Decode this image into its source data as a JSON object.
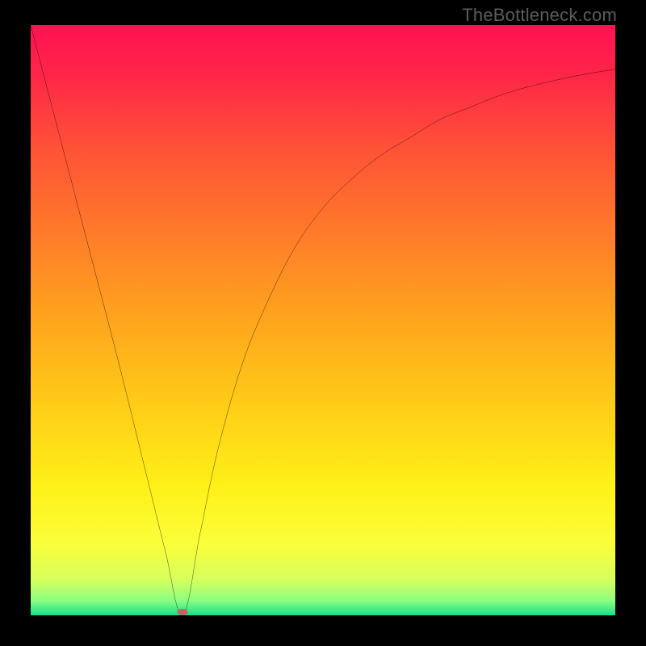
{
  "watermark": "TheBottleneck.com",
  "marker": {
    "x_pct": 26.0,
    "y_pct": 99.4
  },
  "gradient_stops": [
    {
      "offset": 0,
      "color": "#ff1253"
    },
    {
      "offset": 0.08,
      "color": "#ff2448"
    },
    {
      "offset": 0.2,
      "color": "#ff4f38"
    },
    {
      "offset": 0.35,
      "color": "#ff7a2a"
    },
    {
      "offset": 0.5,
      "color": "#ffa51d"
    },
    {
      "offset": 0.65,
      "color": "#ffce17"
    },
    {
      "offset": 0.78,
      "color": "#fff019"
    },
    {
      "offset": 0.88,
      "color": "#faff3a"
    },
    {
      "offset": 0.94,
      "color": "#d6ff5e"
    },
    {
      "offset": 0.975,
      "color": "#8bff82"
    },
    {
      "offset": 1.0,
      "color": "#14e08b"
    }
  ],
  "chart_data": {
    "type": "line",
    "title": "",
    "xlabel": "",
    "ylabel": "",
    "xlim": [
      0,
      100
    ],
    "ylim": [
      0,
      100
    ],
    "grid": false,
    "legend": false,
    "series": [
      {
        "name": "bottleneck-curve",
        "x": [
          0,
          5,
          10,
          15,
          20,
          23,
          26,
          29,
          32,
          36,
          40,
          45,
          50,
          55,
          60,
          65,
          70,
          75,
          80,
          85,
          90,
          95,
          100
        ],
        "y": [
          100,
          81,
          62,
          43,
          23,
          11,
          0,
          14,
          28,
          42,
          52,
          62,
          69,
          74,
          78,
          81,
          84,
          86,
          88,
          89.5,
          90.7,
          91.7,
          92.5
        ]
      }
    ],
    "annotations": [
      {
        "type": "point",
        "x": 26,
        "y": 0,
        "label": ""
      }
    ]
  }
}
